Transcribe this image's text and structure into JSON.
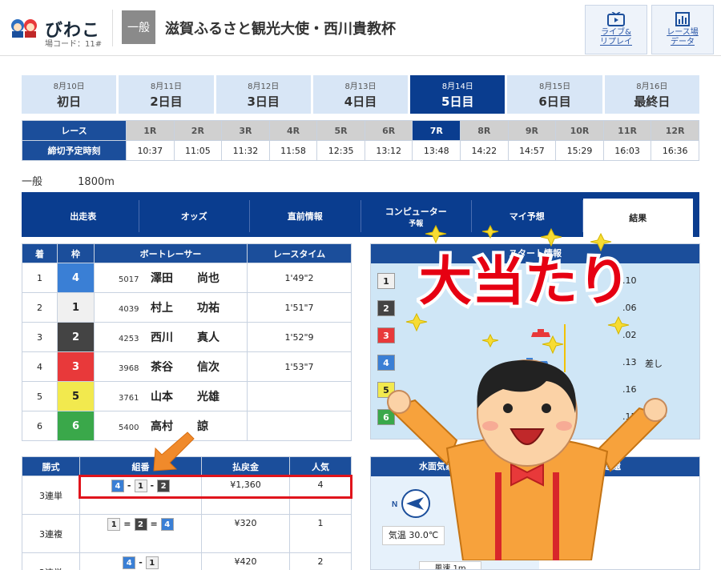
{
  "header": {
    "venue_name": "びわこ",
    "venue_code": "場コード：11#",
    "grade": "一般",
    "race_title": "滋賀ふるさと観光大使・西川貴教杯",
    "live_button_line1": "ライブ&",
    "live_button_line2": "リプレイ",
    "data_button_line1": "レース場",
    "data_button_line2": "データ"
  },
  "days": [
    {
      "date": "8月10日",
      "label": "初日"
    },
    {
      "date": "8月11日",
      "label": "2日目"
    },
    {
      "date": "8月12日",
      "label": "3日目"
    },
    {
      "date": "8月13日",
      "label": "4日目"
    },
    {
      "date": "8月14日",
      "label": "5日目"
    },
    {
      "date": "8月15日",
      "label": "6日目"
    },
    {
      "date": "8月16日",
      "label": "最終日"
    }
  ],
  "active_day_index": 4,
  "race_table": {
    "race_label": "レース",
    "deadline_label": "締切予定時刻",
    "races": [
      "1R",
      "2R",
      "3R",
      "4R",
      "5R",
      "6R",
      "7R",
      "8R",
      "9R",
      "10R",
      "11R",
      "12R"
    ],
    "times": [
      "10:37",
      "11:05",
      "11:32",
      "11:58",
      "12:35",
      "13:12",
      "13:48",
      "14:22",
      "14:57",
      "15:29",
      "16:03",
      "16:36"
    ],
    "active_race_index": 6
  },
  "race_info": {
    "class": "一般",
    "distance": "1800m"
  },
  "nav_tabs": [
    {
      "label": "出走表",
      "sub": ""
    },
    {
      "label": "オッズ",
      "sub": ""
    },
    {
      "label": "直前情報",
      "sub": ""
    },
    {
      "label": "コンピューター",
      "sub": "予報"
    },
    {
      "label": "マイ予想",
      "sub": ""
    },
    {
      "label": "結果",
      "sub": ""
    }
  ],
  "results": {
    "headers": [
      "着",
      "枠",
      "ボートレーサー",
      "レースタイム"
    ],
    "rows": [
      {
        "place": "1",
        "frame": "4",
        "num": "5017",
        "family": "澤田",
        "given": "尚也",
        "time": "1'49\"2"
      },
      {
        "place": "2",
        "frame": "1",
        "num": "4039",
        "family": "村上",
        "given": "功祐",
        "time": "1'51\"7"
      },
      {
        "place": "3",
        "frame": "2",
        "num": "4253",
        "family": "西川",
        "given": "真人",
        "time": "1'52\"9"
      },
      {
        "place": "4",
        "frame": "3",
        "num": "3968",
        "family": "茶谷",
        "given": "信次",
        "time": "1'53\"7"
      },
      {
        "place": "5",
        "frame": "5",
        "num": "3761",
        "family": "山本",
        "given": "光雄",
        "time": ""
      },
      {
        "place": "6",
        "frame": "6",
        "num": "5400",
        "family": "高村",
        "given": "諒",
        "time": ""
      }
    ]
  },
  "frame_colors": {
    "1": "#f0f0f0",
    "2": "#444444",
    "3": "#e8393a",
    "4": "#3a7fd5",
    "5": "#f2e94e",
    "6": "#3aa84a"
  },
  "frame_text_colors": {
    "1": "#222222",
    "2": "#ffffff",
    "3": "#ffffff",
    "4": "#ffffff",
    "5": "#222222",
    "6": "#ffffff"
  },
  "start_info": {
    "title": "スタート情報",
    "lanes": [
      "1",
      "2",
      "3",
      "4",
      "5",
      "6"
    ],
    "st": [
      ".10",
      ".06",
      ".02",
      ".13",
      ".16",
      ".15"
    ],
    "memo": [
      "",
      "",
      "",
      "差し",
      "",
      ""
    ]
  },
  "payout": {
    "headers": [
      "勝式",
      "組番",
      "払戻金",
      "人気"
    ],
    "rows": [
      {
        "type": "3連単",
        "combo": [
          "4",
          "1",
          "2"
        ],
        "seps": [
          "-",
          "-"
        ],
        "amount": "¥1,360",
        "pop": "4"
      },
      {
        "type": "3連複",
        "combo": [
          "1",
          "2",
          "4"
        ],
        "seps": [
          "=",
          "="
        ],
        "amount": "¥320",
        "pop": "1"
      },
      {
        "type": "2連単",
        "combo": [
          "4",
          "1"
        ],
        "seps": [
          "-"
        ],
        "amount": "¥420",
        "pop": "2"
      }
    ]
  },
  "weather": {
    "title_left": "水面気象情報",
    "title_right": "返還",
    "temp": "気温 30.0℃",
    "wind": "風速 1m",
    "compass_label": "N"
  },
  "overlay": {
    "banner_text": "大当たり"
  }
}
